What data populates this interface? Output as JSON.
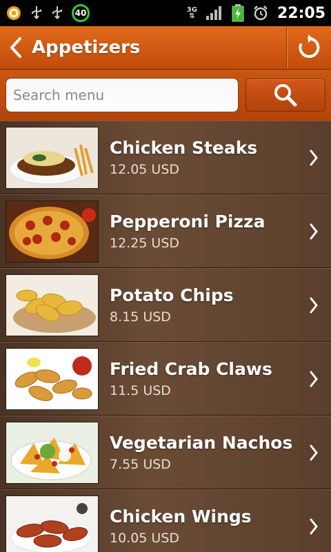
{
  "status_bar": {
    "battery_badge": "40",
    "network": "3G",
    "time": "22:05"
  },
  "header": {
    "title": "Appetizers",
    "back_icon": "chevron-left-icon",
    "refresh_icon": "refresh-icon"
  },
  "search": {
    "placeholder": "Search menu",
    "value": "",
    "button_icon": "search-icon"
  },
  "colors": {
    "header": "#d35b14",
    "row_bg": "#5a3f2c",
    "text": "#ffffff"
  },
  "items": [
    {
      "name": "Chicken Steaks",
      "price": "12.05 USD"
    },
    {
      "name": "Pepperoni Pizza",
      "price": "12.25 USD"
    },
    {
      "name": "Potato Chips",
      "price": "8.15 USD"
    },
    {
      "name": "Fried Crab Claws",
      "price": "11.5 USD"
    },
    {
      "name": "Vegetarian Nachos",
      "price": "7.55 USD"
    },
    {
      "name": "Chicken Wings",
      "price": "10.05 USD"
    }
  ]
}
